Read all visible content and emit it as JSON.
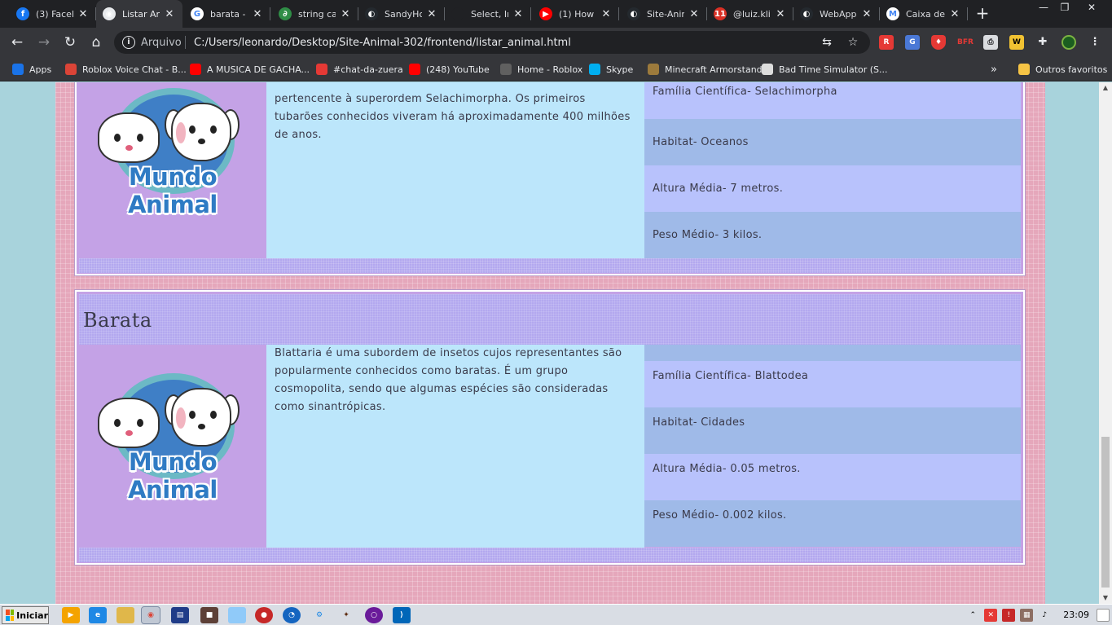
{
  "browser": {
    "tabs": [
      {
        "label": "(3) Faceb",
        "icon": "facebook-icon",
        "color": "#1877f2",
        "glyph": "f"
      },
      {
        "label": "Listar An",
        "icon": "globe-icon",
        "color": "#e8eaed",
        "glyph": "◉",
        "active": true
      },
      {
        "label": "barata - ",
        "icon": "google-icon",
        "color": "#ffffff",
        "glyph": "G"
      },
      {
        "label": "string ca",
        "icon": "geeksforgeeks-icon",
        "color": "#2f8d46",
        "glyph": "∂"
      },
      {
        "label": "SandyHo",
        "icon": "github-icon",
        "color": "#24292e",
        "glyph": "◐"
      },
      {
        "label": "Select, Ir",
        "icon": "blank-icon",
        "color": "#202124",
        "glyph": ""
      },
      {
        "label": "(1) How t",
        "icon": "youtube-icon",
        "color": "#ff0000",
        "glyph": "▶"
      },
      {
        "label": "Site-Anim",
        "icon": "github-icon",
        "color": "#24292e",
        "glyph": "◐"
      },
      {
        "label": "@luiz.klit",
        "icon": "calendar-icon",
        "color": "#d93025",
        "glyph": "11"
      },
      {
        "label": "WebApp",
        "icon": "github-icon",
        "color": "#24292e",
        "glyph": "◐"
      },
      {
        "label": "Caixa de",
        "icon": "gmail-icon",
        "color": "#ffffff",
        "glyph": "M"
      }
    ],
    "address": {
      "scheme": "Arquivo",
      "url": "C:/Users/leonardo/Desktop/Site-Animal-302/frontend/listar_animal.html"
    },
    "bookmarks": [
      {
        "label": "Apps",
        "icon": "apps-grid-icon",
        "color": "#1a73e8"
      },
      {
        "label": "Roblox Voice Chat - B...",
        "icon": "chrome-icon",
        "color": "#db4437"
      },
      {
        "label": "A MUSICA DE GACHA...",
        "icon": "youtube-icon",
        "color": "#ff0000"
      },
      {
        "label": "#chat-da-zuera",
        "icon": "notification-icon",
        "color": "#e53935"
      },
      {
        "label": "(248) YouTube",
        "icon": "youtube-icon",
        "color": "#ff0000"
      },
      {
        "label": "Home - Roblox",
        "icon": "roblox-icon",
        "color": "#606060"
      },
      {
        "label": "Skype",
        "icon": "skype-icon",
        "color": "#00aff0"
      },
      {
        "label": "Minecraft Armorstand",
        "icon": "armorstand-icon",
        "color": "#9c7a3c"
      },
      {
        "label": "Bad Time Simulator (S...",
        "icon": "skull-icon",
        "color": "#dddddd"
      }
    ],
    "bookmarks_more": "»",
    "other_favorites": "Outros favoritos"
  },
  "animals": [
    {
      "name": "",
      "logo_text": "Mundo Animal",
      "description": "pertencente à superordem Selachimorpha. Os primeiros tubarões conhecidos viveram há aproximadamente 400 milhões de anos.",
      "props": {
        "familia": "Família Científica- Selachimorpha",
        "habitat": "Habitat- Oceanos",
        "altura": "Altura Média- 7 metros.",
        "peso": "Peso Médio- 3 kilos."
      }
    },
    {
      "name": "Barata",
      "logo_text": "Mundo Animal",
      "description": "Blattaria é uma subordem de insetos cujos representantes são popularmente conhecidos como baratas. É um grupo cosmopolita, sendo que algumas espécies são consideradas como sinantrópicas.",
      "props": {
        "familia": "Família Científica- Blattodea",
        "habitat": "Habitat- Cidades",
        "altura": "Altura Média- 0.05 metros.",
        "peso": "Peso Médio- 0.002 kilos."
      }
    }
  ],
  "taskbar": {
    "start_label": "Iniciar",
    "clock": "23:09"
  }
}
